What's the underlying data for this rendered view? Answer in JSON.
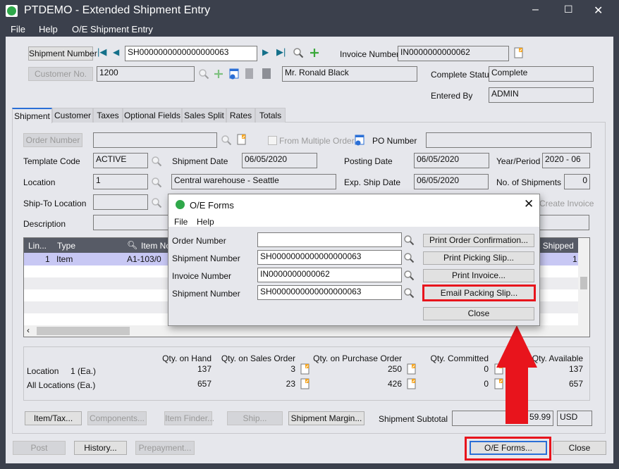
{
  "window": {
    "title": "PTDEMO - Extended Shipment Entry",
    "controls": [
      "–",
      "☐",
      "✕"
    ]
  },
  "menu": [
    "File",
    "Help",
    "O/E Shipment Entry"
  ],
  "header": {
    "shipment_number_button": "Shipment Number",
    "shipment_number": "SH0000000000000000063",
    "invoice_number_label": "Invoice Number",
    "invoice_number": "IN0000000000062",
    "customer_no_button": "Customer No.",
    "customer_no": "1200",
    "customer_name": "Mr. Ronald Black",
    "complete_status_label": "Complete Status",
    "complete_status": "Complete",
    "entered_by_label": "Entered By",
    "entered_by": "ADMIN"
  },
  "tabs": [
    "Shipment",
    "Customer",
    "Taxes",
    "Optional Fields",
    "Sales Split",
    "Rates",
    "Totals"
  ],
  "shipment": {
    "order_number_button": "Order Number",
    "from_multiple_orders": "From Multiple Orders",
    "from_multiple_orders_checked": false,
    "po_number_label": "PO Number",
    "po_number": "",
    "template_code_label": "Template Code",
    "template_code": "ACTIVE",
    "shipment_date_label": "Shipment Date",
    "shipment_date": "06/05/2020",
    "posting_date_label": "Posting Date",
    "posting_date": "06/05/2020",
    "year_period_label": "Year/Period",
    "year_period": "2020 - 06",
    "location_label": "Location",
    "location": "1",
    "location_desc": "Central warehouse - Seattle",
    "exp_ship_date_label": "Exp. Ship Date",
    "exp_ship_date": "06/05/2020",
    "no_shipments_label": "No. of Shipments",
    "no_shipments": "0",
    "ship_to_label": "Ship-To Location",
    "create_invoice": "Create Invoice",
    "description_label": "Description"
  },
  "grid": {
    "columns": [
      "Lin...",
      "Type",
      "Item No",
      "y. Shipped"
    ],
    "rows": [
      {
        "line": "1",
        "type": "Item",
        "item": "A1-103/0",
        "shipped": "1"
      }
    ]
  },
  "qty": {
    "headers": [
      "Qty. on Hand",
      "Qty. on Sales Order",
      "Qty. on Purchase Order",
      "Qty. Committed",
      "Qty. Available"
    ],
    "rows": [
      {
        "label": "Location     1 (Ea.)",
        "values": [
          "137",
          "3",
          "250",
          "0",
          "137"
        ]
      },
      {
        "label": "All Locations (Ea.)",
        "values": [
          "657",
          "23",
          "426",
          "0",
          "657"
        ]
      }
    ]
  },
  "buttons": {
    "item_tax": "Item/Tax...",
    "components": "Components...",
    "item_finder": "Item Finder...",
    "ship": "Ship...",
    "shipment_margin": "Shipment Margin...",
    "subtotal_label": "Shipment Subtotal",
    "subtotal": "59.99",
    "currency": "USD",
    "post": "Post",
    "history": "History...",
    "prepayment": "Prepayment...",
    "oe_forms": "O/E Forms...",
    "close": "Close"
  },
  "dialog": {
    "title": "O/E Forms",
    "menu": [
      "File",
      "Help"
    ],
    "fields": [
      {
        "label": "Order Number",
        "value": ""
      },
      {
        "label": "Shipment Number",
        "value": "SH0000000000000000063"
      },
      {
        "label": "Invoice Number",
        "value": "IN0000000000062"
      },
      {
        "label": "Shipment Number",
        "value": "SH0000000000000000063"
      }
    ],
    "buttons": [
      "Print Order Confirmation...",
      "Print Picking Slip...",
      "Print Invoice...",
      "Email Packing Slip...",
      "Close"
    ]
  },
  "colors": {
    "highlight": "#e8141c",
    "accent": "#2a6fd6",
    "selected_row": "#c8c8f4"
  }
}
